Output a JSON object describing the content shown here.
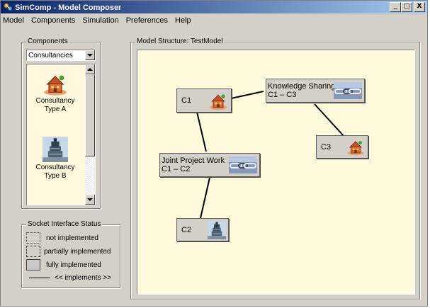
{
  "window": {
    "title": "SimComp - Model Composer",
    "minimize": "_",
    "maximize": "□",
    "close": "X"
  },
  "menu": [
    "Model",
    "Components",
    "Simulation",
    "Preferences",
    "Help"
  ],
  "components": {
    "legend": "Components",
    "category": "Consultancies",
    "items": [
      {
        "label_line1": "Consultancy",
        "label_line2": "Type A",
        "icon": "house-icon"
      },
      {
        "label_line1": "Consultancy",
        "label_line2": "Type B",
        "icon": "tower-icon"
      }
    ]
  },
  "socket_status": {
    "legend": "Socket Interface Status",
    "rows": [
      {
        "label": "not implemented",
        "style": "dotted"
      },
      {
        "label": "partially implemented",
        "style": "dashed"
      },
      {
        "label": "fully implemented",
        "style": "solid"
      },
      {
        "label": "<< implements >>",
        "style": "line"
      }
    ]
  },
  "model": {
    "legend": "Model Structure: TestModel",
    "nodes": [
      {
        "id": "C1",
        "label": "C1",
        "icon": "house-icon"
      },
      {
        "id": "C2",
        "label": "C2",
        "icon": "tower-icon"
      },
      {
        "id": "C3",
        "label": "C3",
        "icon": "house-icon"
      },
      {
        "id": "KS",
        "label_line1": "Knowledge Sharing",
        "label_line2": "C1 – C3",
        "icon": "chain-link-icon"
      },
      {
        "id": "JP",
        "label_line1": "Joint Project Work",
        "label_line2": "C1 – C2",
        "icon": "chain-link-icon"
      }
    ],
    "links": [
      {
        "from": "C1",
        "to": "KS"
      },
      {
        "from": "KS",
        "to": "C3"
      },
      {
        "from": "C1",
        "to": "JP"
      },
      {
        "from": "JP",
        "to": "C2"
      }
    ]
  },
  "colors": {
    "canvas_bg": "#fdfbdc",
    "title_gradient_start": "#0a246a",
    "title_gradient_end": "#a6caf0"
  }
}
